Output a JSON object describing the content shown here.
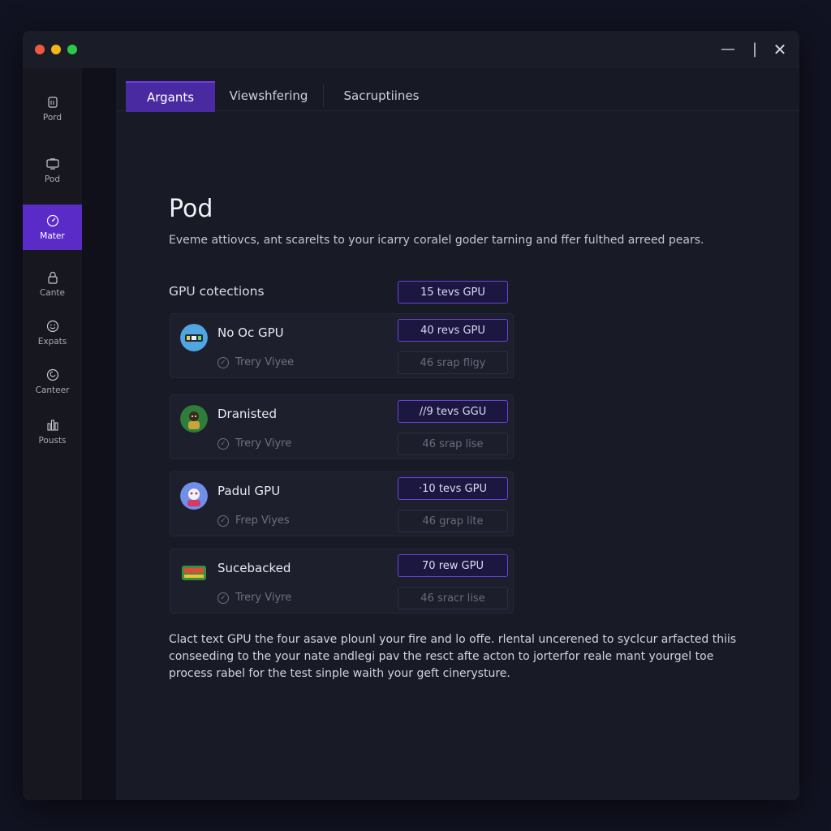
{
  "window": {
    "controls": {
      "minimize": "—",
      "maximize": "|",
      "close": "✕"
    }
  },
  "sidebar": {
    "items": [
      {
        "label": "Pord",
        "icon": "doc-icon"
      },
      {
        "label": "Pod",
        "icon": "monitor-icon"
      },
      {
        "label": "Mater",
        "icon": "gauge-icon",
        "active": true
      },
      {
        "label": "Cante",
        "icon": "lock-icon"
      },
      {
        "label": "Expats",
        "icon": "smile-icon"
      },
      {
        "label": "Canteer",
        "icon": "globe-icon"
      },
      {
        "label": "Pousts",
        "icon": "chart-icon"
      }
    ]
  },
  "tabs": [
    {
      "label": "Argants",
      "active": true
    },
    {
      "label": "Viewshfering"
    },
    {
      "label": "Sacruptiines"
    }
  ],
  "main": {
    "title": "Pod",
    "description": "Eveme attiovcs, ant scarelts to your icarry coralel goder tarning and ffer fulthed arreed pears.",
    "section_label": "GPU cotections",
    "section_pill": "15 tevs GPU",
    "cards": [
      {
        "title": "No Oc GPU",
        "sub": "Trery Viyee",
        "primary": "40 revs GPU",
        "secondary": "46 srap fligy"
      },
      {
        "title": "Dranisted",
        "sub": "Trery Viyre",
        "primary": "//9 tevs GGU",
        "secondary": "46 srap lise"
      },
      {
        "title": "Padul GPU",
        "sub": "Frep Viyes",
        "primary": "·10 tevs GPU",
        "secondary": "46 grap lite"
      },
      {
        "title": "Sucebacked",
        "sub": "Trery Viyre",
        "primary": "70 rew GPU",
        "secondary": "46 sracr lise"
      }
    ],
    "footer": [
      "Clact text GPU the four asave plounl your fire and lo offe. rlental uncerened to syclcur arfacted thiis",
      "conseeding to the your nate andlegi pav the resct afte acton to jorterfor reale mant yourgel toe",
      "process rabel for the test sinple waith your geft cinerysture."
    ]
  },
  "colors": {
    "accent": "#5b2bc7",
    "background": "#181a26",
    "pill_border": "#6a43d8"
  }
}
